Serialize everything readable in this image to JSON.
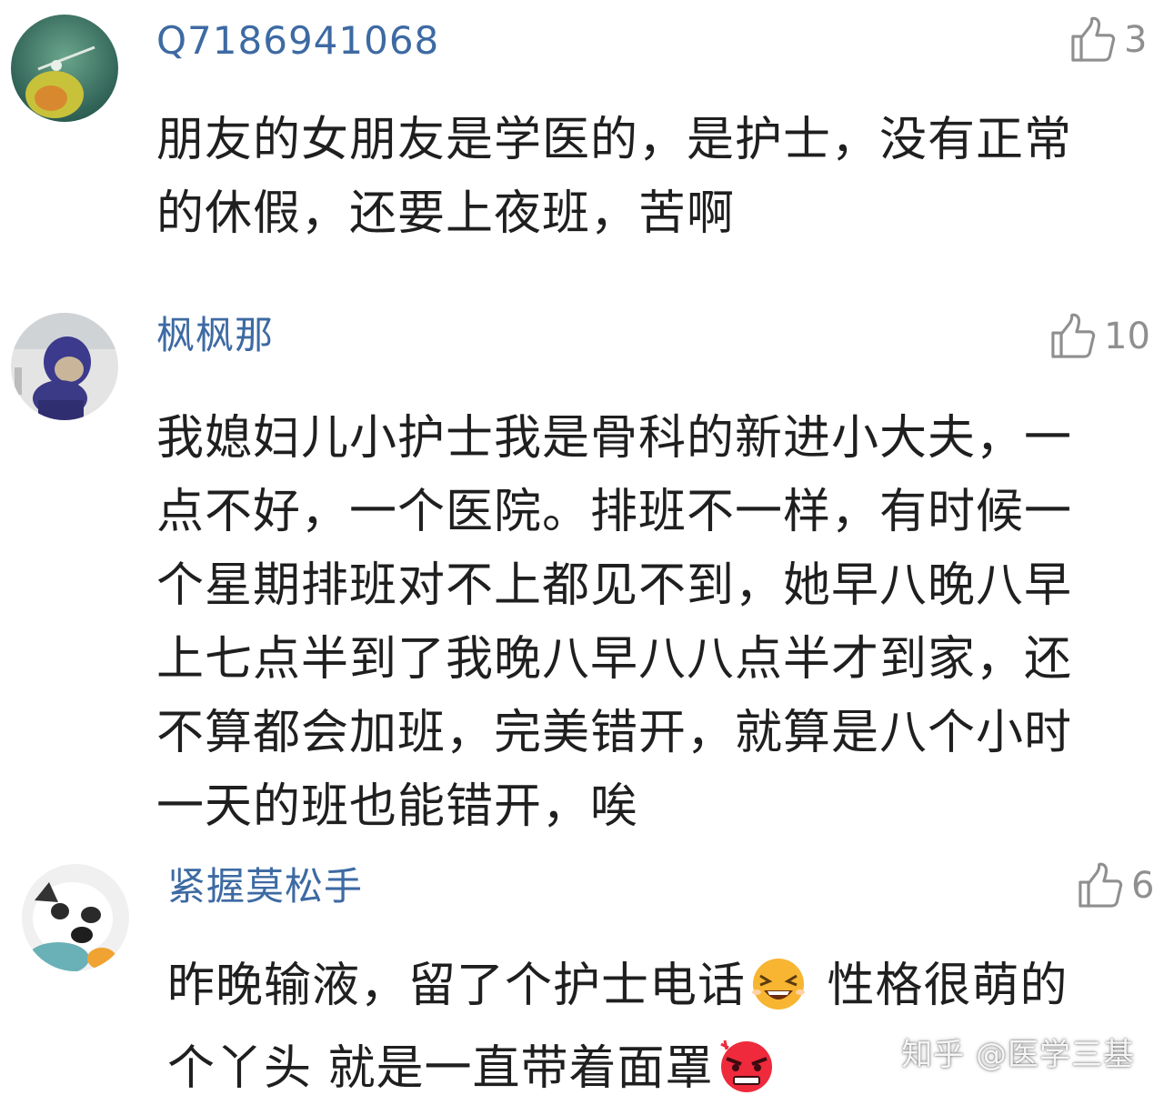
{
  "comments": [
    {
      "username": "Q7186941068",
      "likes": "3",
      "lines": [
        "朋友的女朋友是学医的，是护士，没有正常",
        "的休假，还要上夜班，苦啊"
      ]
    },
    {
      "username": "枫枫那",
      "likes": "10",
      "lines": [
        "我媳妇儿小护士我是骨科的新进小大夫，一",
        "点不好，一个医院。排班不一样，有时候一",
        "个星期排班对不上都见不到，她早八晚八早",
        "上七点半到了我晚八早八八点半才到家，还",
        "不算都会加班，完美错开，就算是八个小时",
        "一天的班也能错开，唉"
      ]
    },
    {
      "username": "紧握莫松手",
      "likes": "6",
      "line1_a": "昨晚输液，留了个护士电话",
      "line1_b": " 性格很萌的",
      "line2": "个丫头 就是一直带着面罩"
    }
  ],
  "watermark": "知乎 @医学三基",
  "colors": {
    "username": "#3d6aa3",
    "text": "#1f1f1f",
    "like": "#8f8f8f"
  }
}
